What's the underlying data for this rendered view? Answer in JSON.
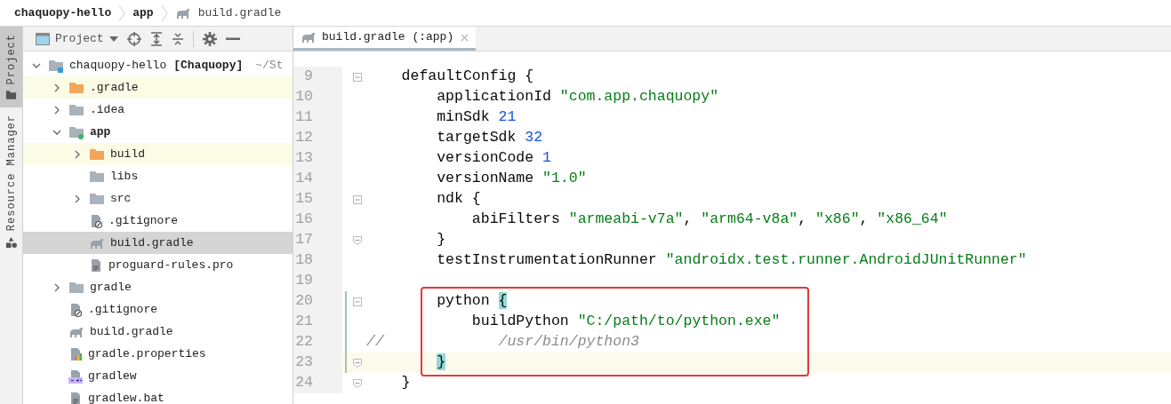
{
  "breadcrumb": [
    {
      "label": "chaquopy-hello",
      "kind": "folder"
    },
    {
      "label": "app",
      "kind": "folder"
    },
    {
      "label": "build.gradle",
      "kind": "gradle"
    }
  ],
  "tool_strip": [
    {
      "label": "Project",
      "kind": "folder",
      "selected": true
    },
    {
      "label": "Resource Manager",
      "kind": "resources",
      "selected": false
    }
  ],
  "project_panel": {
    "view_label": "Project",
    "tree": [
      {
        "name": "chaquopy-hello",
        "module_name": "[Chaquopy]",
        "location": "~/St",
        "kind": "root-module",
        "expanded": true,
        "excluded": false,
        "selected": false,
        "children": [
          {
            "name": ".gradle",
            "kind": "folder",
            "expanded": false,
            "excluded": true,
            "selected": false
          },
          {
            "name": ".idea",
            "kind": "folder",
            "expanded": false,
            "excluded": false,
            "selected": false
          },
          {
            "name": "app",
            "kind": "module",
            "expanded": true,
            "excluded": false,
            "selected": false,
            "children": [
              {
                "name": "build",
                "kind": "folder",
                "expanded": false,
                "excluded": true,
                "selected": false
              },
              {
                "name": "libs",
                "kind": "folder",
                "excluded": false,
                "selected": false
              },
              {
                "name": "src",
                "kind": "folder",
                "expanded": false,
                "excluded": false,
                "selected": false
              },
              {
                "name": ".gitignore",
                "kind": "ignore-file",
                "excluded": false,
                "selected": false
              },
              {
                "name": "build.gradle",
                "kind": "gradle",
                "excluded": false,
                "selected": true
              },
              {
                "name": "proguard-rules.pro",
                "kind": "text-file",
                "excluded": false,
                "selected": false
              }
            ]
          },
          {
            "name": "gradle",
            "kind": "folder",
            "expanded": false,
            "excluded": false,
            "selected": false
          },
          {
            "name": ".gitignore",
            "kind": "ignore-file",
            "excluded": false,
            "selected": false
          },
          {
            "name": "build.gradle",
            "kind": "gradle",
            "excluded": false,
            "selected": false
          },
          {
            "name": "gradle.properties",
            "kind": "properties",
            "excluded": false,
            "selected": false
          },
          {
            "name": "gradlew",
            "kind": "script",
            "excluded": false,
            "selected": false
          },
          {
            "name": "gradlew.bat",
            "kind": "text-file",
            "excluded": false,
            "selected": false
          }
        ]
      }
    ]
  },
  "editor": {
    "tabs": [
      {
        "label": "build.gradle (:app)",
        "selected": true
      }
    ],
    "lines": [
      {
        "number": "9",
        "kind": "fold-start",
        "changed": false,
        "current": false,
        "framed": false,
        "tokens": [
          {
            "text": "    defaultConfig {",
            "kind": "plain"
          }
        ]
      },
      {
        "number": "10",
        "kind": "plain",
        "changed": false,
        "current": false,
        "framed": false,
        "tokens": [
          {
            "text": "        applicationId ",
            "kind": "plain"
          },
          {
            "text": "\"com.app.chaquopy\"",
            "kind": "string"
          }
        ]
      },
      {
        "number": "11",
        "kind": "plain",
        "changed": false,
        "current": false,
        "framed": false,
        "tokens": [
          {
            "text": "        minSdk ",
            "kind": "plain"
          },
          {
            "text": "21",
            "kind": "number"
          }
        ]
      },
      {
        "number": "12",
        "kind": "plain",
        "changed": false,
        "current": false,
        "framed": false,
        "tokens": [
          {
            "text": "        targetSdk ",
            "kind": "plain"
          },
          {
            "text": "32",
            "kind": "number"
          }
        ]
      },
      {
        "number": "13",
        "kind": "plain",
        "changed": false,
        "current": false,
        "framed": false,
        "tokens": [
          {
            "text": "        versionCode ",
            "kind": "plain"
          },
          {
            "text": "1",
            "kind": "number"
          }
        ]
      },
      {
        "number": "14",
        "kind": "plain",
        "changed": false,
        "current": false,
        "framed": false,
        "tokens": [
          {
            "text": "        versionName ",
            "kind": "plain"
          },
          {
            "text": "\"1.0\"",
            "kind": "string"
          }
        ]
      },
      {
        "number": "15",
        "kind": "fold-start",
        "changed": false,
        "current": false,
        "framed": false,
        "tokens": [
          {
            "text": "        ndk {",
            "kind": "plain"
          }
        ]
      },
      {
        "number": "16",
        "kind": "plain",
        "changed": false,
        "current": false,
        "framed": false,
        "tokens": [
          {
            "text": "            abiFilters ",
            "kind": "plain"
          },
          {
            "text": "\"armeabi-v7a\"",
            "kind": "string"
          },
          {
            "text": ", ",
            "kind": "plain"
          },
          {
            "text": "\"arm64-v8a\"",
            "kind": "string"
          },
          {
            "text": ", ",
            "kind": "plain"
          },
          {
            "text": "\"x86\"",
            "kind": "string"
          },
          {
            "text": ", ",
            "kind": "plain"
          },
          {
            "text": "\"x86_64\"",
            "kind": "string"
          }
        ]
      },
      {
        "number": "17",
        "kind": "fold-end",
        "changed": false,
        "current": false,
        "framed": false,
        "tokens": [
          {
            "text": "        }",
            "kind": "plain"
          }
        ]
      },
      {
        "number": "18",
        "kind": "plain",
        "changed": false,
        "current": false,
        "framed": false,
        "tokens": [
          {
            "text": "        testInstrumentationRunner ",
            "kind": "plain"
          },
          {
            "text": "\"androidx.test.runner.AndroidJUnitRunner\"",
            "kind": "string"
          }
        ]
      },
      {
        "number": "19",
        "kind": "plain",
        "changed": false,
        "current": false,
        "framed": false
      },
      {
        "number": "20",
        "kind": "fold-start",
        "changed": true,
        "current": false,
        "framed": true,
        "tokens": [
          {
            "text": "        python ",
            "kind": "plain"
          },
          {
            "text": "{",
            "kind": "matched-brace"
          }
        ]
      },
      {
        "number": "21",
        "kind": "plain",
        "changed": true,
        "current": false,
        "framed": true,
        "tokens": [
          {
            "text": "            buildPython ",
            "kind": "plain"
          },
          {
            "text": "\"C:/path/to/python.exe\"",
            "kind": "string"
          }
        ]
      },
      {
        "number": "22",
        "kind": "plain",
        "changed": true,
        "current": false,
        "framed": true,
        "tokens": [
          {
            "text": "//",
            "kind": "comment"
          },
          {
            "text": "             /usr/bin/python3",
            "kind": "comment"
          }
        ]
      },
      {
        "number": "23",
        "kind": "fold-end",
        "changed": true,
        "current": true,
        "framed": true,
        "tokens": [
          {
            "text": "        }",
            "kind": "matched-brace"
          }
        ]
      },
      {
        "number": "24",
        "kind": "fold-end",
        "changed": false,
        "current": false,
        "framed": false,
        "tokens": [
          {
            "text": "    }",
            "kind": "plain"
          }
        ]
      }
    ]
  }
}
